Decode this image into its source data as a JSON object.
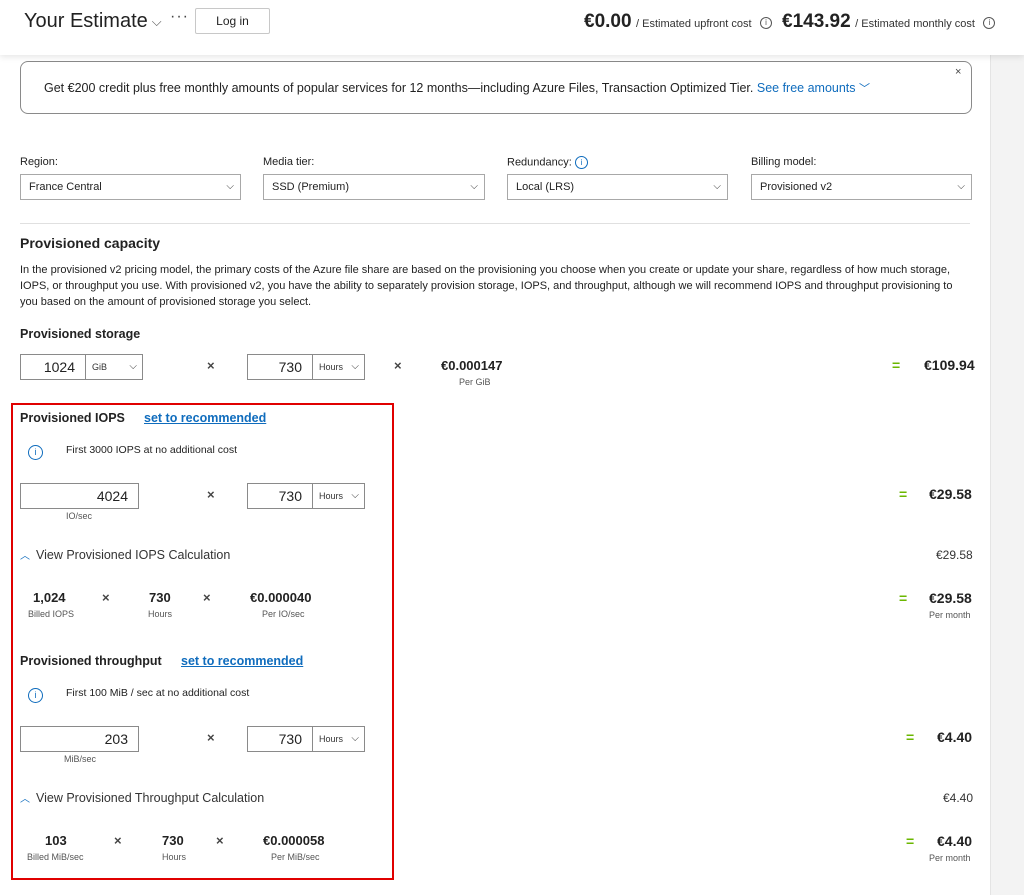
{
  "header": {
    "title": "Your Estimate",
    "more": "···",
    "login": "Log in",
    "upfront_value": "€0.00",
    "upfront_label": "/ Estimated upfront cost",
    "monthly_value": "€143.92",
    "monthly_label": "/ Estimated monthly cost"
  },
  "banner": {
    "text": "Get €200 credit plus free monthly amounts of popular services for 12 months—including Azure Files, Transaction Optimized Tier.",
    "link": "See free amounts",
    "close": "×"
  },
  "filters": {
    "region_label": "Region:",
    "region_value": "France Central",
    "media_label": "Media tier:",
    "media_value": "SSD (Premium)",
    "redundancy_label": "Redundancy:",
    "redundancy_value": "Local (LRS)",
    "billing_label": "Billing model:",
    "billing_value": "Provisioned v2"
  },
  "capacity": {
    "title": "Provisioned capacity",
    "description": "In the provisioned v2 pricing model, the primary costs of the Azure file share are based on the provisioning you choose when you create or update your share, regardless of how much storage, IOPS, or throughput you use. With provisioned v2, you have the ability to separately provision storage, IOPS, and throughput, although we will recommend IOPS and throughput provisioning to you based on the amount of provisioned storage you select."
  },
  "storage": {
    "title": "Provisioned storage",
    "amount": "1024",
    "unit": "GiB",
    "hours": "730",
    "hours_unit": "Hours",
    "price": "€0.000147",
    "price_caption": "Per GiB",
    "total": "€109.94"
  },
  "iops": {
    "title": "Provisioned IOPS",
    "recommend": "set to recommended",
    "info": "First 3000 IOPS at no additional cost",
    "amount": "4024",
    "amount_caption": "IO/sec",
    "hours": "730",
    "hours_unit": "Hours",
    "total": "€29.58",
    "calc_toggle": "View Provisioned IOPS Calculation",
    "calc_total_plain": "€29.58",
    "billed": "1,024",
    "billed_caption": "Billed IOPS",
    "calc_hours": "730",
    "calc_hours_caption": "Hours",
    "rate": "€0.000040",
    "rate_caption": "Per IO/sec",
    "calc_total": "€29.58",
    "calc_total_caption": "Per month"
  },
  "throughput": {
    "title": "Provisioned throughput",
    "recommend": "set to recommended",
    "info": "First 100 MiB / sec at no additional cost",
    "amount": "203",
    "amount_caption": "MiB/sec",
    "hours": "730",
    "hours_unit": "Hours",
    "total": "€4.40",
    "calc_toggle": "View Provisioned Throughput Calculation",
    "calc_total_plain": "€4.40",
    "billed": "103",
    "billed_caption": "Billed MiB/sec",
    "calc_hours": "730",
    "calc_hours_caption": "Hours",
    "rate": "€0.000058",
    "rate_caption": "Per MiB/sec",
    "calc_total": "€4.40",
    "calc_total_caption": "Per month"
  },
  "symbols": {
    "times": "×",
    "equals": "="
  },
  "colors": {
    "accent": "#0f6cbd",
    "equals": "#6bb700",
    "highlight": "#e00000"
  }
}
